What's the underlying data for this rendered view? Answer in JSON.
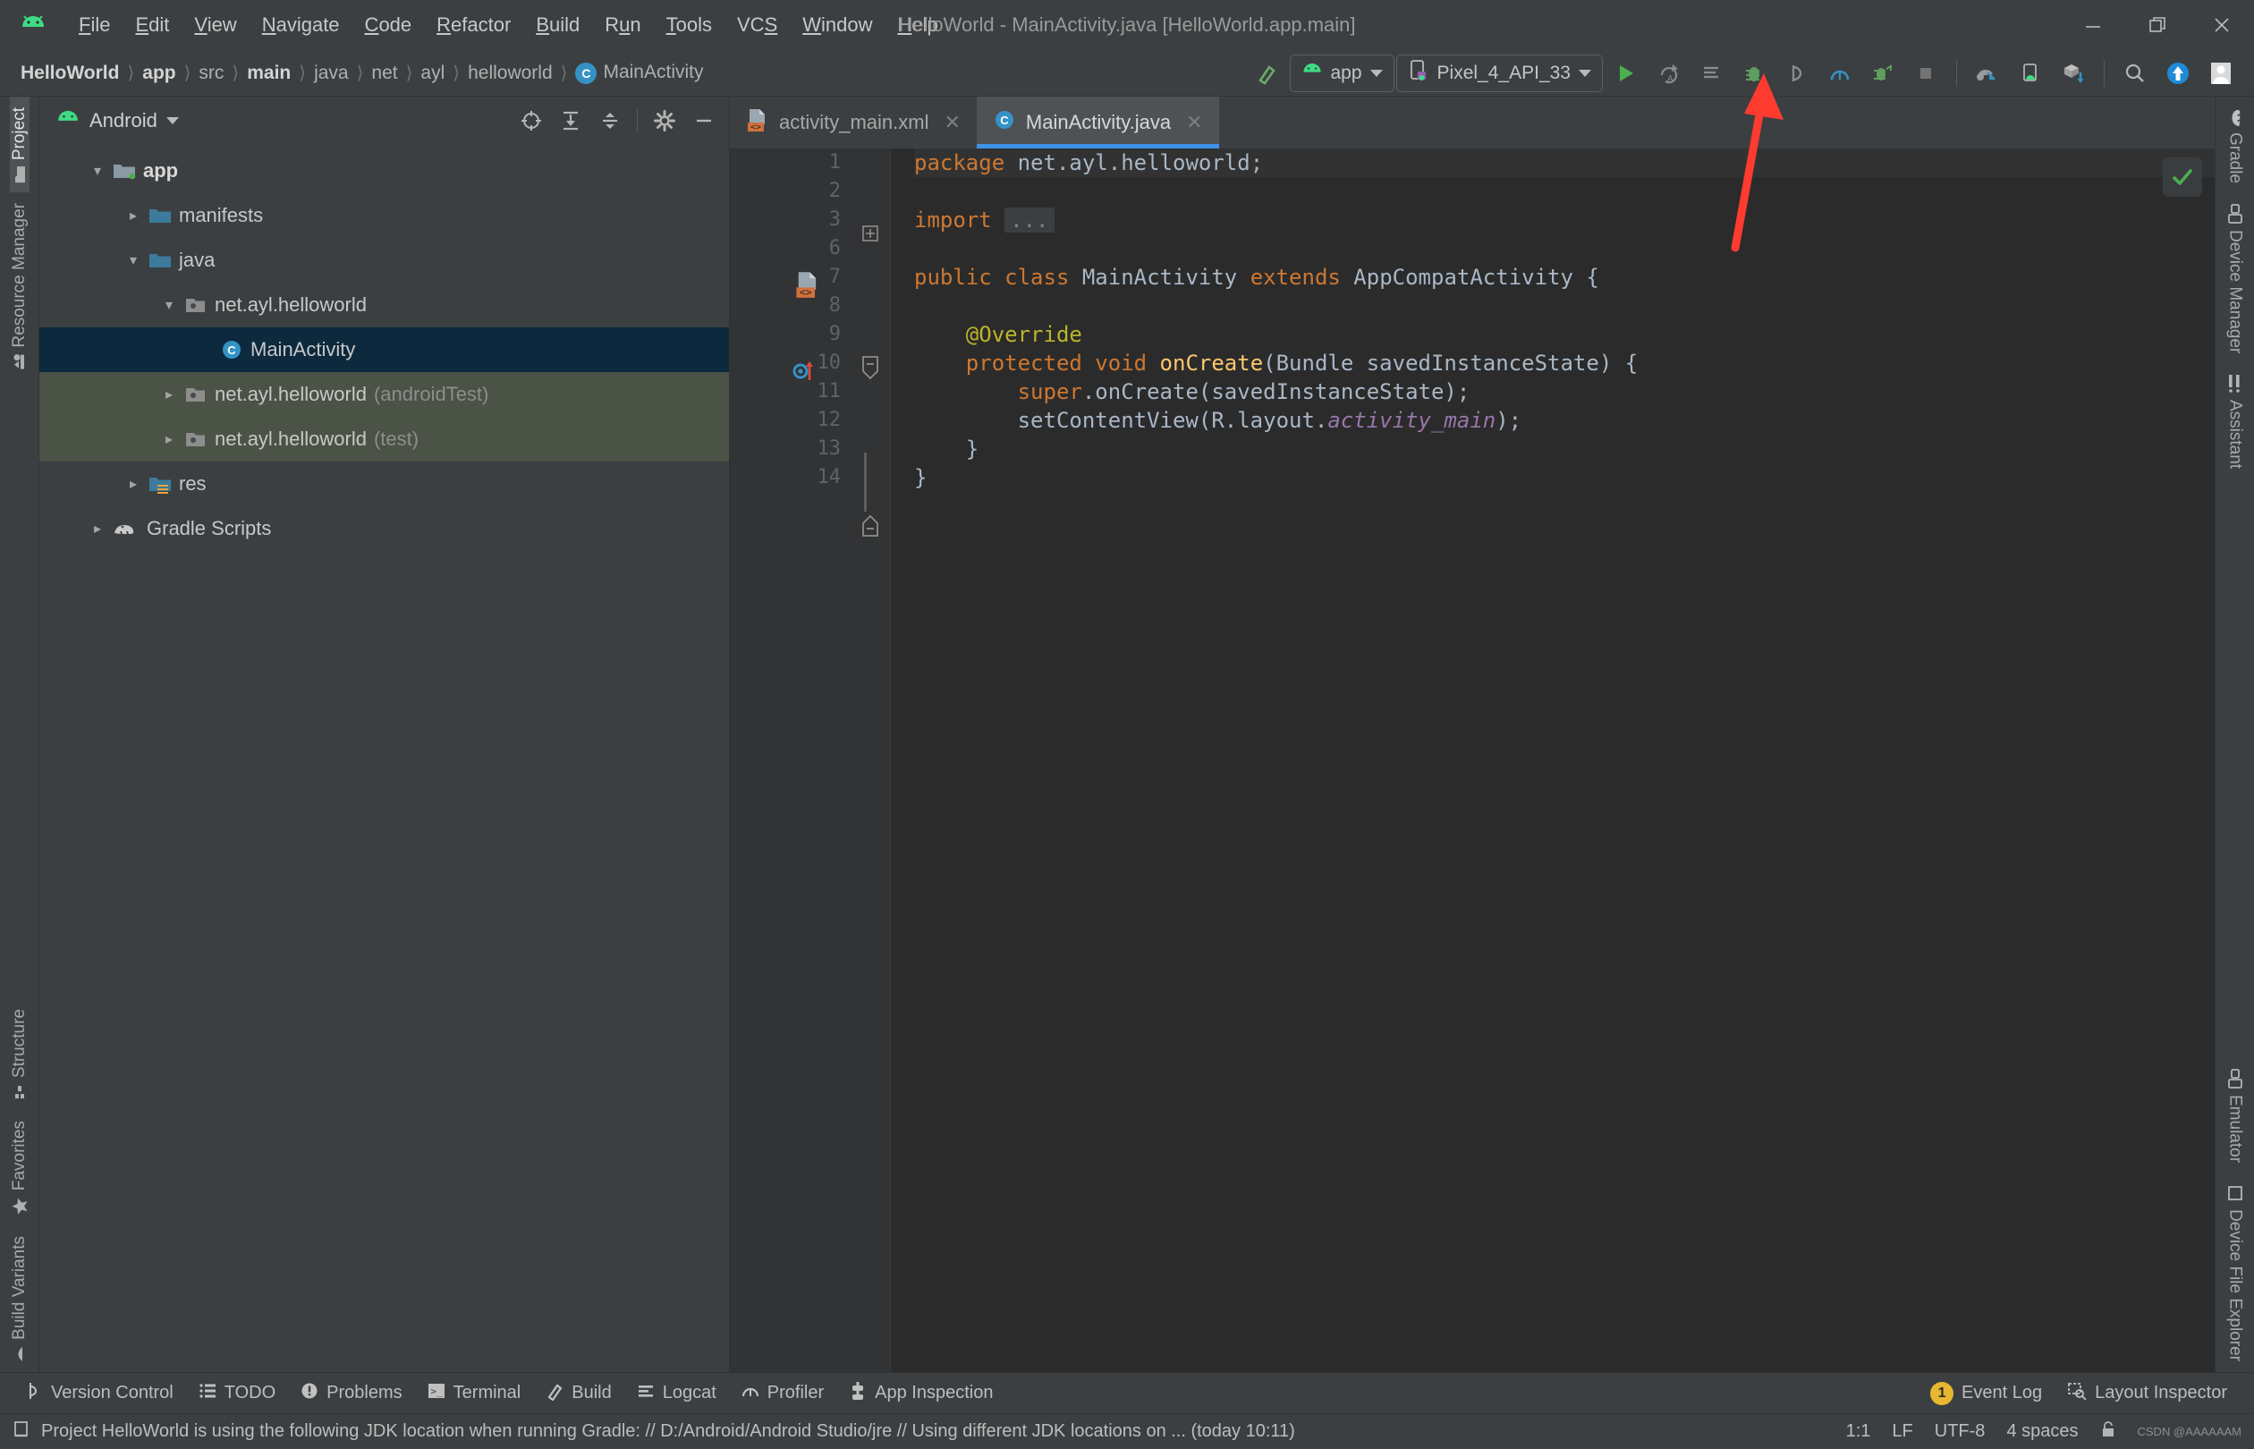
{
  "window": {
    "title": "HelloWorld - MainActivity.java [HelloWorld.app.main]",
    "logo_icon": "android-logo-icon",
    "minimize_icon": "minimize-icon",
    "restore_icon": "restore-icon",
    "close_icon": "close-icon"
  },
  "menu": [
    {
      "label": "File",
      "mnemonic": "F"
    },
    {
      "label": "Edit",
      "mnemonic": "E"
    },
    {
      "label": "View",
      "mnemonic": "V"
    },
    {
      "label": "Navigate",
      "mnemonic": "N"
    },
    {
      "label": "Code",
      "mnemonic": "C"
    },
    {
      "label": "Refactor",
      "mnemonic": "R"
    },
    {
      "label": "Build",
      "mnemonic": "B"
    },
    {
      "label": "Run",
      "mnemonic": "u"
    },
    {
      "label": "Tools",
      "mnemonic": "T"
    },
    {
      "label": "VCS",
      "mnemonic": "S"
    },
    {
      "label": "Window",
      "mnemonic": "W"
    },
    {
      "label": "Help",
      "mnemonic": "H"
    }
  ],
  "breadcrumbs": [
    {
      "label": "HelloWorld",
      "bold": true
    },
    {
      "label": "app",
      "bold": true
    },
    {
      "label": "src",
      "bold": false
    },
    {
      "label": "main",
      "bold": true
    },
    {
      "label": "java",
      "bold": false
    },
    {
      "label": "net",
      "bold": false
    },
    {
      "label": "ayl",
      "bold": false
    },
    {
      "label": "helloworld",
      "bold": false
    },
    {
      "label": "MainActivity",
      "bold": false,
      "icon": "class-icon"
    }
  ],
  "toolbar": {
    "build_icon": "hammer-build-icon",
    "run_config_label": "app",
    "run_config_icon": "android-app-icon",
    "device_label": "Pixel_4_API_33",
    "device_icon": "device-phone-icon",
    "run_icon": "run-play-icon",
    "apply_changes_icon": "apply-changes-icon",
    "apply_code_changes_icon": "apply-code-changes-icon",
    "debug_icon": "debug-bug-icon",
    "attach_debugger_icon": "attach-debugger-icon",
    "profiler_icon": "profiler-icon",
    "run_coverage_icon": "run-with-coverage-icon",
    "stop_icon": "stop-icon",
    "gradle_sync_icon": "gradle-sync-icon",
    "avd_manager_icon": "avd-manager-icon",
    "sdk_manager_icon": "sdk-manager-icon",
    "search_icon": "search-icon",
    "update_icon": "update-arrow-icon",
    "avatar_icon": "user-avatar-icon"
  },
  "left_strip": [
    {
      "label": "Project",
      "icon": "project-folder-icon",
      "active": true
    },
    {
      "label": "Resource Manager",
      "icon": "resource-manager-icon",
      "active": false
    },
    {
      "label": "Structure",
      "icon": "structure-icon",
      "active": false
    },
    {
      "label": "Favorites",
      "icon": "favorites-star-icon",
      "active": false
    },
    {
      "label": "Build Variants",
      "icon": "build-variants-icon",
      "active": false
    }
  ],
  "right_strip": [
    {
      "label": "Gradle",
      "icon": "gradle-elephant-icon"
    },
    {
      "label": "Device Manager",
      "icon": "device-manager-icon"
    },
    {
      "label": "Assistant",
      "icon": "assistant-icon"
    },
    {
      "label": "Emulator",
      "icon": "emulator-icon"
    },
    {
      "label": "Device File Explorer",
      "icon": "device-file-explorer-icon"
    }
  ],
  "project_panel": {
    "title": "Android",
    "title_icon": "android-head-icon",
    "dropdown_icon": "chevron-down-icon",
    "tools": [
      {
        "name": "select-opened-file-icon"
      },
      {
        "name": "expand-all-icon"
      },
      {
        "name": "collapse-all-icon"
      },
      {
        "name": "settings-gear-icon"
      },
      {
        "name": "hide-panel-icon"
      }
    ],
    "tree": [
      {
        "label": "app",
        "indent": 0,
        "arrow": "v",
        "icon": "module-folder-icon",
        "bold": true,
        "state": "normal",
        "dim": ""
      },
      {
        "label": "manifests",
        "indent": 1,
        "arrow": ">",
        "icon": "folder-icon",
        "bold": false,
        "state": "normal",
        "dim": ""
      },
      {
        "label": "java",
        "indent": 1,
        "arrow": "v",
        "icon": "folder-icon",
        "bold": false,
        "state": "normal",
        "dim": ""
      },
      {
        "label": "net.ayl.helloworld",
        "indent": 2,
        "arrow": "v",
        "icon": "package-icon",
        "bold": false,
        "state": "normal",
        "dim": ""
      },
      {
        "label": "MainActivity",
        "indent": 3,
        "arrow": "",
        "icon": "class-icon",
        "bold": false,
        "state": "selected",
        "dim": ""
      },
      {
        "label": "net.ayl.helloworld",
        "indent": 2,
        "arrow": ">",
        "icon": "package-icon",
        "bold": false,
        "state": "testscope",
        "dim": "(androidTest)"
      },
      {
        "label": "net.ayl.helloworld",
        "indent": 2,
        "arrow": ">",
        "icon": "package-icon",
        "bold": false,
        "state": "testscope",
        "dim": "(test)"
      },
      {
        "label": "res",
        "indent": 1,
        "arrow": ">",
        "icon": "res-folder-icon",
        "bold": false,
        "state": "normal",
        "dim": ""
      },
      {
        "label": "Gradle Scripts",
        "indent": 0,
        "arrow": ">",
        "icon": "gradle-elephant-icon",
        "bold": false,
        "state": "normal",
        "dim": ""
      }
    ]
  },
  "editor": {
    "tabs": [
      {
        "label": "activity_main.xml",
        "icon": "xml-layout-icon",
        "active": false,
        "close_icon": "close-icon"
      },
      {
        "label": "MainActivity.java",
        "icon": "class-icon",
        "active": true,
        "close_icon": "close-icon"
      }
    ],
    "inspection_icon": "inspection-ok-check-icon",
    "line_numbers": [
      "1",
      "2",
      "3",
      "6",
      "7",
      "8",
      "9",
      "10",
      "11",
      "12",
      "13",
      "14"
    ],
    "code_lines": [
      {
        "n": "1",
        "tokens": [
          {
            "t": "package",
            "c": "kw"
          },
          {
            "t": " net.ayl.helloworld",
            "c": "ident"
          },
          {
            "t": ";",
            "c": "punct"
          }
        ]
      },
      {
        "n": "2",
        "tokens": []
      },
      {
        "n": "3",
        "tokens": [
          {
            "t": "import",
            "c": "kw"
          },
          {
            "t": " ",
            "c": "ident"
          },
          {
            "t": "...",
            "c": "fold"
          }
        ]
      },
      {
        "n": "6",
        "tokens": []
      },
      {
        "n": "7",
        "tokens": [
          {
            "t": "public class",
            "c": "kw"
          },
          {
            "t": " MainActivity ",
            "c": "ident"
          },
          {
            "t": "extends",
            "c": "kw"
          },
          {
            "t": " AppCompatActivity ",
            "c": "ident"
          },
          {
            "t": "{",
            "c": "punct"
          }
        ]
      },
      {
        "n": "8",
        "tokens": []
      },
      {
        "n": "9",
        "tokens": [
          {
            "t": "    @Override",
            "c": "ann"
          }
        ]
      },
      {
        "n": "10",
        "tokens": [
          {
            "t": "    protected void",
            "c": "kw"
          },
          {
            "t": " ",
            "c": "ident"
          },
          {
            "t": "onCreate",
            "c": "fn"
          },
          {
            "t": "(Bundle savedInstanceState) {",
            "c": "ident"
          }
        ]
      },
      {
        "n": "11",
        "tokens": [
          {
            "t": "        ",
            "c": "ident"
          },
          {
            "t": "super",
            "c": "kw"
          },
          {
            "t": ".onCreate(savedInstanceState);",
            "c": "ident"
          }
        ]
      },
      {
        "n": "12",
        "tokens": [
          {
            "t": "        setContentView(R.layout.",
            "c": "ident"
          },
          {
            "t": "activity_main",
            "c": "fld"
          },
          {
            "t": ");",
            "c": "ident"
          }
        ]
      },
      {
        "n": "13",
        "tokens": [
          {
            "t": "    }",
            "c": "punct"
          }
        ]
      },
      {
        "n": "14",
        "tokens": [
          {
            "t": "}",
            "c": "punct"
          }
        ]
      }
    ],
    "gutter_markers": [
      {
        "line": "7",
        "icon": "related-layout-file-icon"
      },
      {
        "line": "10",
        "icon": "overriding-method-icon"
      }
    ],
    "annotation_arrow": {
      "name": "red-pointer-arrow",
      "color": "#ff3b30"
    }
  },
  "bottom_bar": [
    {
      "label": "Version Control",
      "icon": "version-control-icon"
    },
    {
      "label": "TODO",
      "icon": "todo-list-icon"
    },
    {
      "label": "Problems",
      "icon": "problems-icon"
    },
    {
      "label": "Terminal",
      "icon": "terminal-icon"
    },
    {
      "label": "Build",
      "icon": "build-hammer-icon"
    },
    {
      "label": "Logcat",
      "icon": "logcat-icon"
    },
    {
      "label": "Profiler",
      "icon": "profiler-icon"
    },
    {
      "label": "App Inspection",
      "icon": "app-inspection-icon"
    }
  ],
  "bottom_bar_right": [
    {
      "label": "Event Log",
      "icon": "event-log-icon",
      "badge": "1"
    },
    {
      "label": "Layout Inspector",
      "icon": "layout-inspector-icon",
      "badge": ""
    }
  ],
  "status_bar": {
    "message_icon": "status-message-icon",
    "message": "Project HelloWorld is using the following JDK location when running Gradle: // D:/Android/Android Studio/jre // Using different JDK locations on ... (today 10:11)",
    "caret_position": "1:1",
    "line_separator": "LF",
    "encoding": "UTF-8",
    "indent": "4 spaces",
    "lock_icon": "read-only-lock-icon",
    "watermark_text": "CSDN @AAAAAAM"
  },
  "colors": {
    "chrome": "#3c3f41",
    "editor_bg": "#2b2b2b",
    "gutter_bg": "#313335",
    "selection": "#0d293e",
    "test_scope": "#4b5246",
    "accent_blue": "#3d93e8",
    "run_green": "#4caf50",
    "annotation_red": "#ff3b30",
    "string_orange": "#cc7832"
  }
}
